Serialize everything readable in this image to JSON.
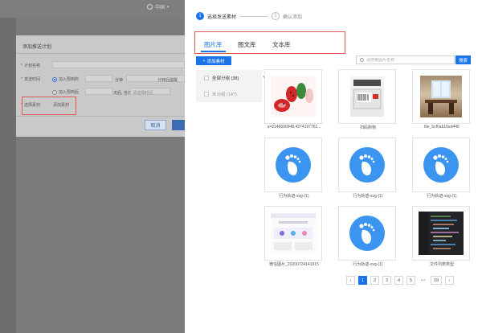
{
  "background_app": {
    "language": "中国",
    "dialog": {
      "title": "添加推送计划",
      "plan_name_label": "计划名称",
      "send_time_label": "发送时间",
      "option_immediate": "加入预到的",
      "option_immediate_unit": "分钟",
      "option_immediate_suffix": "分钟后提醒",
      "option_scheduled": "加入预到后",
      "option_scheduled_unit": "天后, 当日",
      "option_scheduled_time": "请选择时间",
      "material_label": "选择素材",
      "add_material_link": "添加素材",
      "cancel_label": "取消"
    }
  },
  "steps": [
    {
      "number": "1",
      "label": "选择发送素材",
      "active": true
    },
    {
      "number": "2",
      "label": "确认添加",
      "active": false
    }
  ],
  "tabs": [
    {
      "label": "图片库",
      "active": true
    },
    {
      "label": "图文库",
      "active": false
    },
    {
      "label": "文本库",
      "active": false
    }
  ],
  "toolbar": {
    "add_label": "添加素材",
    "search_placeholder": "请搜索图片名称",
    "search_button": "搜索"
  },
  "groups": [
    {
      "label": "全部分组 (38)"
    },
    {
      "label": "未分组 (14?)"
    }
  ],
  "images": [
    {
      "caption": "u=2146690948,4274197751..."
    },
    {
      "caption": "扫码购物"
    },
    {
      "caption": "file_5cf0ab16ed445"
    },
    {
      "caption": "行为轨迹-svg-(1)"
    },
    {
      "caption": "行为轨迹-svg-(1)"
    },
    {
      "caption": "行为轨迹-svg-(1)"
    },
    {
      "caption": "微信图片_20200724141915"
    },
    {
      "caption": "行为轨迹-svg-(1)"
    },
    {
      "caption": "文件列表类型"
    }
  ],
  "pagination": {
    "prev": "‹",
    "pages": [
      "1",
      "2",
      "3",
      "4",
      "5"
    ],
    "ellipsis": "•••",
    "last": "19",
    "next": "›",
    "current": "1"
  }
}
